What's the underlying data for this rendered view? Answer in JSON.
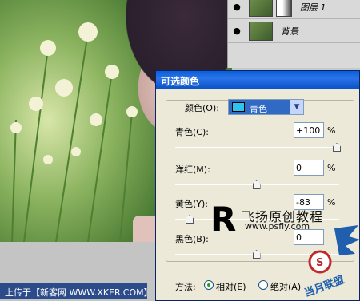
{
  "layers": {
    "rows": [
      {
        "name": "图层 1"
      },
      {
        "name": "背景"
      }
    ]
  },
  "dialog": {
    "title": "可选颜色",
    "color_label": "颜色(O):",
    "color_value": "青色",
    "color_swatch": "#2fc4f0",
    "sliders": [
      {
        "label": "青色(C):",
        "value": "+100",
        "unit": "%",
        "level": 1.0
      },
      {
        "label": "洋红(M):",
        "value": "0",
        "unit": "%",
        "level": 0.5
      },
      {
        "label": "黄色(Y):",
        "value": "-83",
        "unit": "%",
        "level": 0.085
      },
      {
        "label": "黑色(B):",
        "value": "0",
        "unit": "%",
        "level": 0.5
      }
    ],
    "method_label": "方法:",
    "method_relative": "相对(E)",
    "method_absolute": "绝对(A)"
  },
  "watermark": {
    "letter": "R",
    "text": "飞扬原创教程",
    "url": "www.psfly.com"
  },
  "bottom_bar": "上传于【新客网 WWW.XKER.COM】",
  "logo_text": "当月联盟"
}
